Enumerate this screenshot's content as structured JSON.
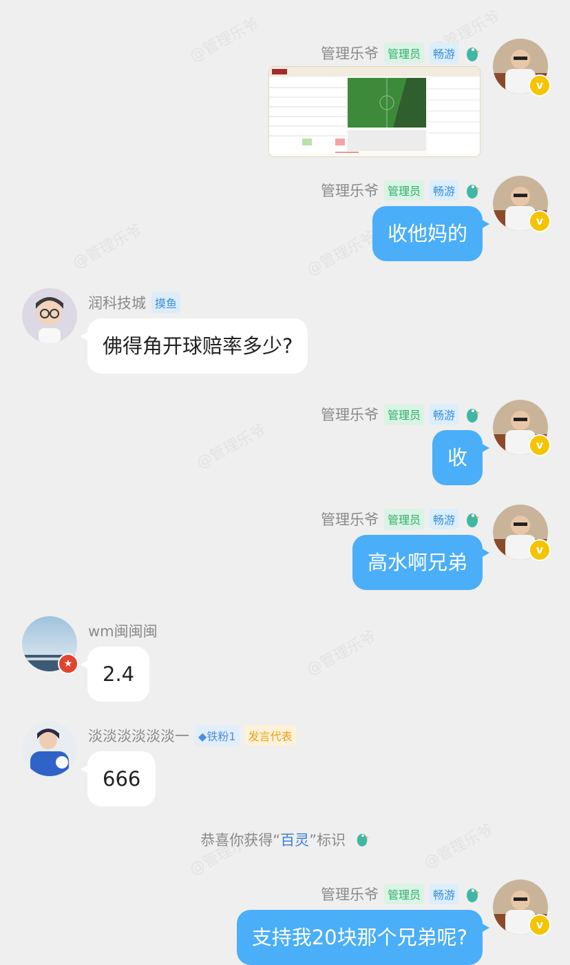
{
  "colors": {
    "bubble_me": "#4aaef8",
    "bubble_other": "#ffffff",
    "background": "#efefef"
  },
  "watermark": "@管理乐爷",
  "messages": [
    {
      "sender": "管理乐爷",
      "tags": [
        "管理员",
        "畅游"
      ],
      "type": "image",
      "side": "right"
    },
    {
      "sender": "管理乐爷",
      "tags": [
        "管理员",
        "畅游"
      ],
      "text": "收他妈的",
      "side": "right"
    },
    {
      "sender": "润科技城",
      "tags": [
        "摸鱼"
      ],
      "text": "佛得角开球赔率多少?",
      "side": "left"
    },
    {
      "sender": "管理乐爷",
      "tags": [
        "管理员",
        "畅游"
      ],
      "text": "收",
      "side": "right"
    },
    {
      "sender": "管理乐爷",
      "tags": [
        "管理员",
        "畅游"
      ],
      "text": "高水啊兄弟",
      "side": "right"
    },
    {
      "sender": "wm闽闽闽",
      "tags": [],
      "text": "2.4",
      "side": "left"
    },
    {
      "sender": "淡淡淡淡淡淡一",
      "tags": [
        "铁粉1",
        "发言代表"
      ],
      "text": "666",
      "side": "left"
    },
    {
      "sender": "管理乐爷",
      "tags": [
        "管理员",
        "畅游"
      ],
      "text": "支持我20块那个兄弟呢?",
      "side": "right"
    }
  ],
  "system_notice": {
    "prefix": "恭喜你获得",
    "open_quote": "“",
    "highlight": "百灵",
    "close_quote": "”",
    "suffix": "标识"
  }
}
